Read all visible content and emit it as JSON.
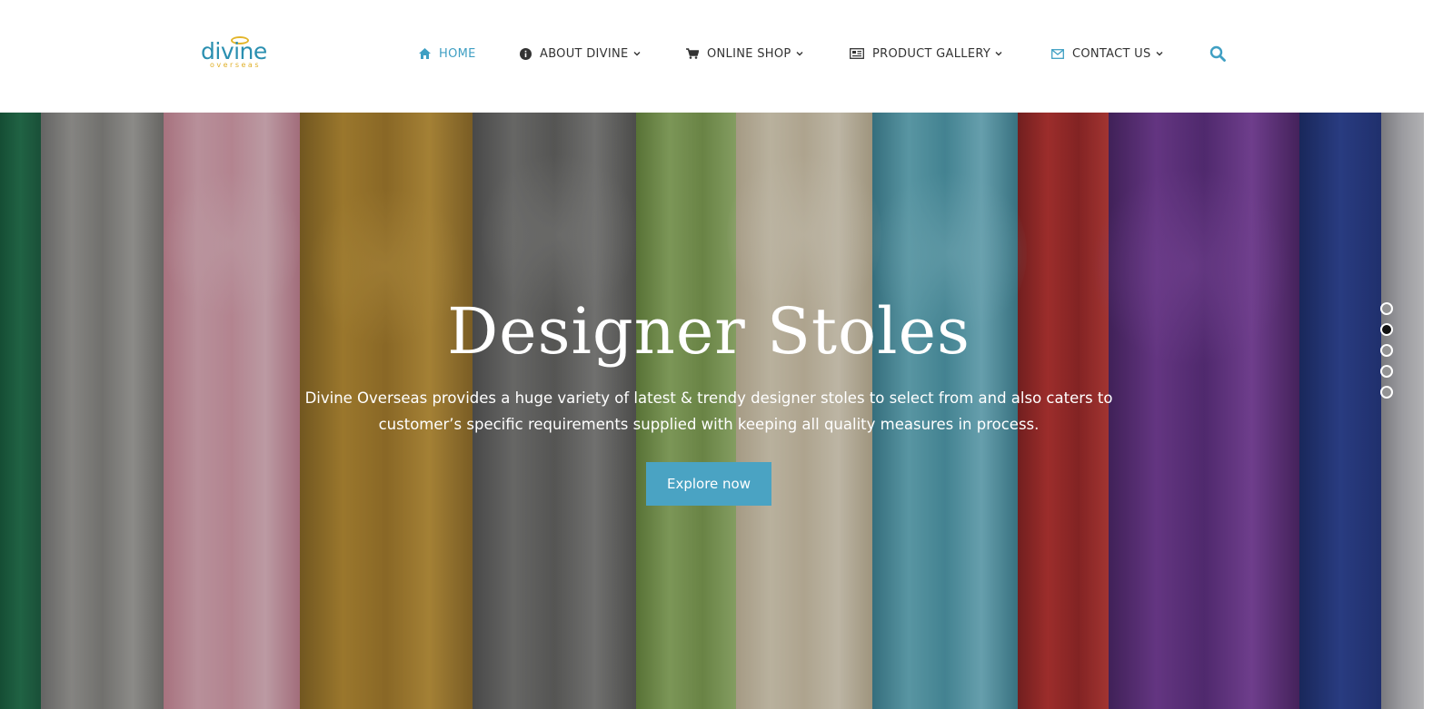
{
  "brand": {
    "logo_word": "divine",
    "logo_sub": "overseas",
    "colors": {
      "primary": "#3f9fc3",
      "accent": "#e3b52a",
      "button": "#4aa3c3"
    }
  },
  "nav": {
    "items": [
      {
        "label": "HOME",
        "icon": "home-icon",
        "has_dropdown": false,
        "active": true
      },
      {
        "label": "ABOUT DIVINE",
        "icon": "info-icon",
        "has_dropdown": true,
        "active": false
      },
      {
        "label": "ONLINE SHOP",
        "icon": "cart-icon",
        "has_dropdown": true,
        "active": false
      },
      {
        "label": "PRODUCT GALLERY",
        "icon": "gallery-icon",
        "has_dropdown": true,
        "active": false
      },
      {
        "label": "CONTACT US",
        "icon": "mail-icon",
        "has_dropdown": true,
        "active": false
      }
    ],
    "search_icon": "search-icon"
  },
  "hero": {
    "title": "Designer Stoles",
    "text_line1": "Divine Overseas provides a huge variety of latest & trendy designer stoles to select from and also caters to",
    "text_line2": "customer’s specific requirements supplied with keeping all quality measures in process.",
    "button_label": "Explore now",
    "slides_count": 5,
    "active_slide": 2
  }
}
